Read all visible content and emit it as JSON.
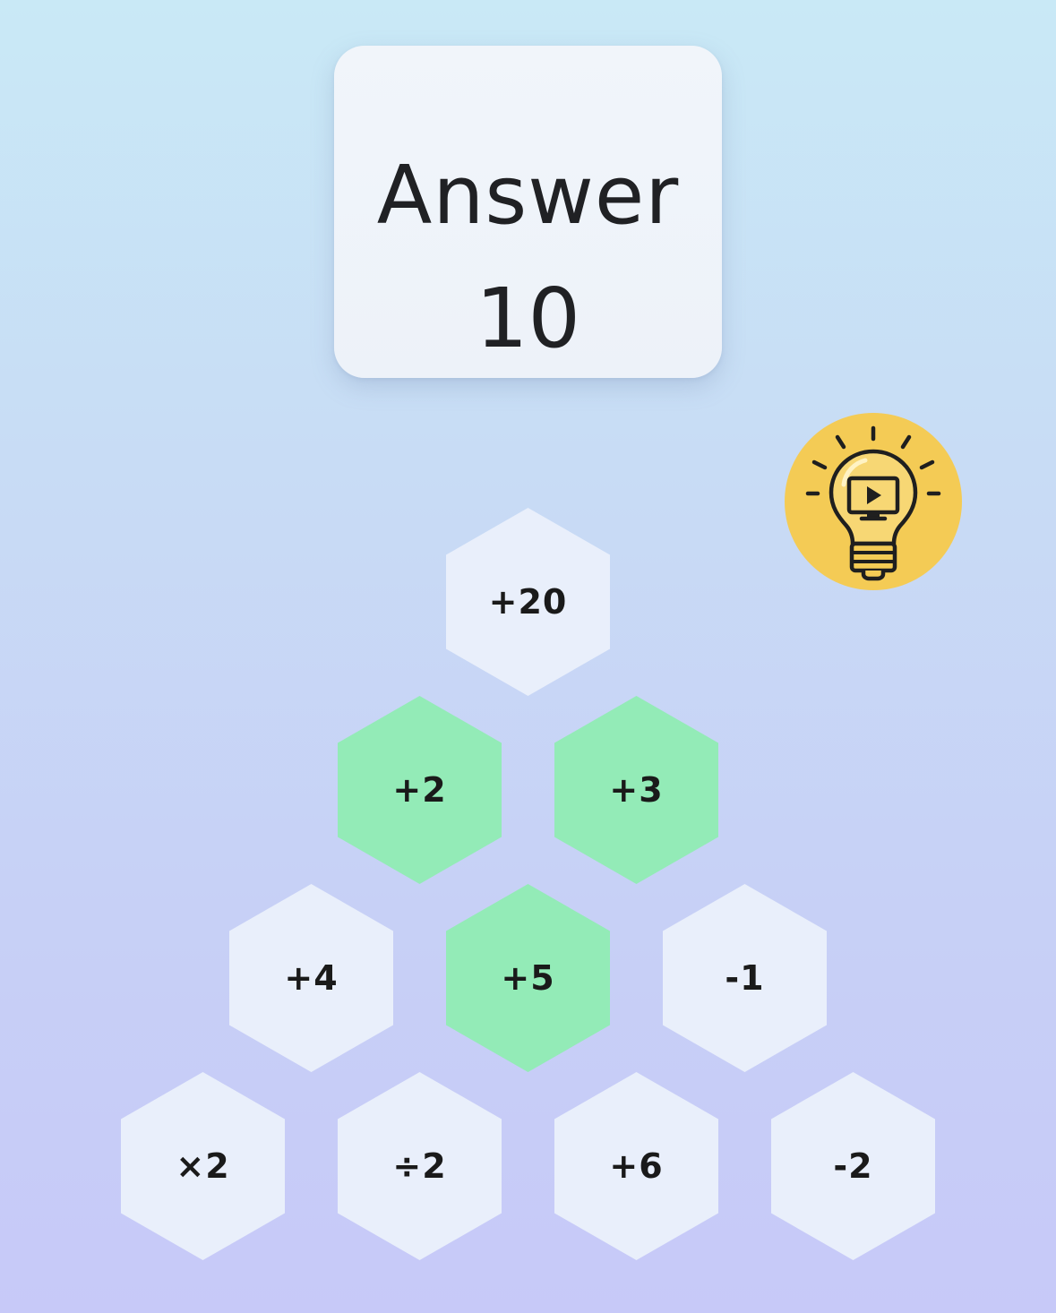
{
  "answer": {
    "label": "Answer",
    "value": "10"
  },
  "hint": {
    "icon": "lightbulb-video-icon",
    "color": "#f4cb55"
  },
  "colors": {
    "tile_default": "#e9effb",
    "tile_selected": "#93ebb7"
  },
  "tiles": [
    {
      "label": "+20",
      "selected": false
    },
    {
      "label": "+2",
      "selected": true
    },
    {
      "label": "+3",
      "selected": true
    },
    {
      "label": "+4",
      "selected": false
    },
    {
      "label": "+5",
      "selected": true
    },
    {
      "label": "-1",
      "selected": false
    },
    {
      "label": "×2",
      "selected": false
    },
    {
      "label": "÷2",
      "selected": false
    },
    {
      "label": "+6",
      "selected": false
    },
    {
      "label": "-2",
      "selected": false
    }
  ]
}
